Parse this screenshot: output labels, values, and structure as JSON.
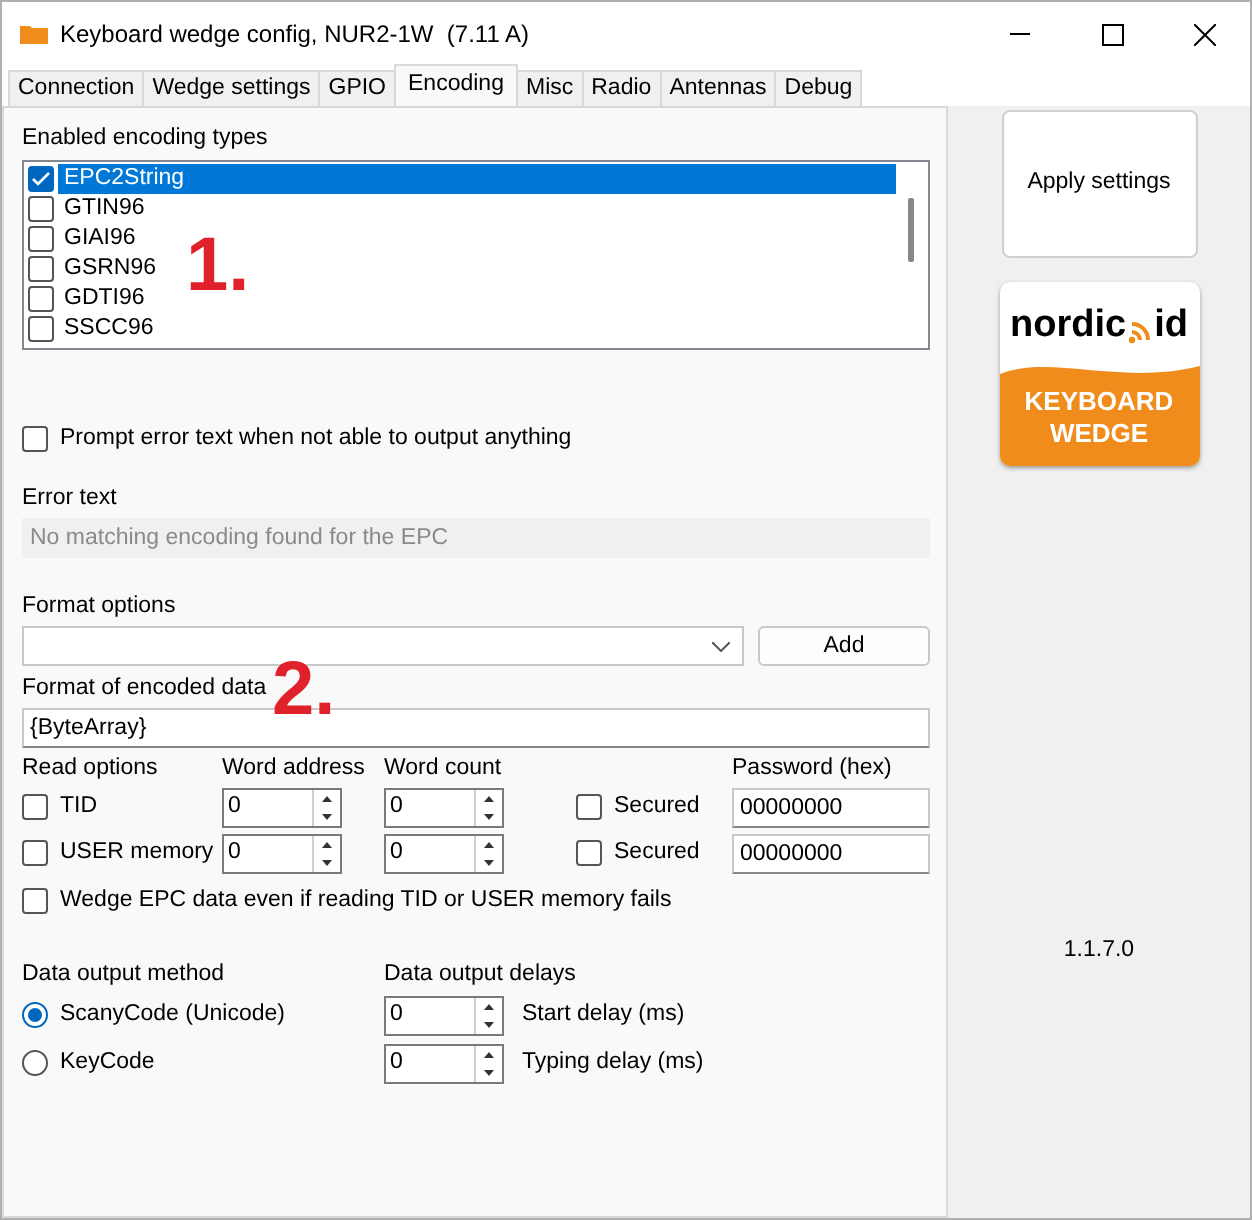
{
  "window": {
    "title": "Keyboard wedge config, NUR2-1W  (7.11 A)"
  },
  "tabs": [
    {
      "label": "Connection",
      "selected": false
    },
    {
      "label": "Wedge settings",
      "selected": false
    },
    {
      "label": "GPIO",
      "selected": false
    },
    {
      "label": "Encoding",
      "selected": true
    },
    {
      "label": "Misc",
      "selected": false
    },
    {
      "label": "Radio",
      "selected": false
    },
    {
      "label": "Antennas",
      "selected": false
    },
    {
      "label": "Debug",
      "selected": false
    }
  ],
  "encoding_types": {
    "label": "Enabled encoding types",
    "items": [
      {
        "label": "EPC2String",
        "checked": true,
        "selected": true
      },
      {
        "label": "GTIN96",
        "checked": false,
        "selected": false
      },
      {
        "label": "GIAI96",
        "checked": false,
        "selected": false
      },
      {
        "label": "GSRN96",
        "checked": false,
        "selected": false
      },
      {
        "label": "GDTI96",
        "checked": false,
        "selected": false
      },
      {
        "label": "SSCC96",
        "checked": false,
        "selected": false
      }
    ]
  },
  "prompt_error": {
    "label": "Prompt error text when not able to output anything",
    "checked": false
  },
  "error_text": {
    "label": "Error text",
    "value": "No matching encoding found for the EPC",
    "disabled": true
  },
  "format_options": {
    "label": "Format options",
    "button": "Add"
  },
  "format_encoded": {
    "label": "Format of encoded data",
    "value": "{ByteArray}"
  },
  "read_options": {
    "headers": [
      "Read options",
      "Word address",
      "Word count",
      "Password (hex)"
    ],
    "rows": [
      {
        "label": "TID",
        "checked": false,
        "word_address": "0",
        "word_count": "0",
        "secured_label": "Secured",
        "secured": false,
        "password": "00000000"
      },
      {
        "label": "USER memory",
        "checked": false,
        "word_address": "0",
        "word_count": "0",
        "secured_label": "Secured",
        "secured": false,
        "password": "00000000"
      }
    ]
  },
  "wedge_epc": {
    "label": "Wedge EPC data even if reading TID or USER memory fails",
    "checked": false
  },
  "output_method": {
    "label": "Data output method",
    "options": [
      {
        "label": "ScanyCode (Unicode)",
        "selected": true
      },
      {
        "label": "KeyCode",
        "selected": false
      }
    ]
  },
  "output_delays": {
    "label": "Data output delays",
    "items": [
      {
        "value": "0",
        "label": "Start delay (ms)"
      },
      {
        "value": "0",
        "label": "Typing delay (ms)"
      }
    ]
  },
  "apply_button": "Apply settings",
  "logo": {
    "brand": [
      "nordic",
      "id"
    ],
    "product": "KEYBOARD WEDGE"
  },
  "version": "1.1.7.0",
  "annotations": [
    "1.",
    "2."
  ]
}
